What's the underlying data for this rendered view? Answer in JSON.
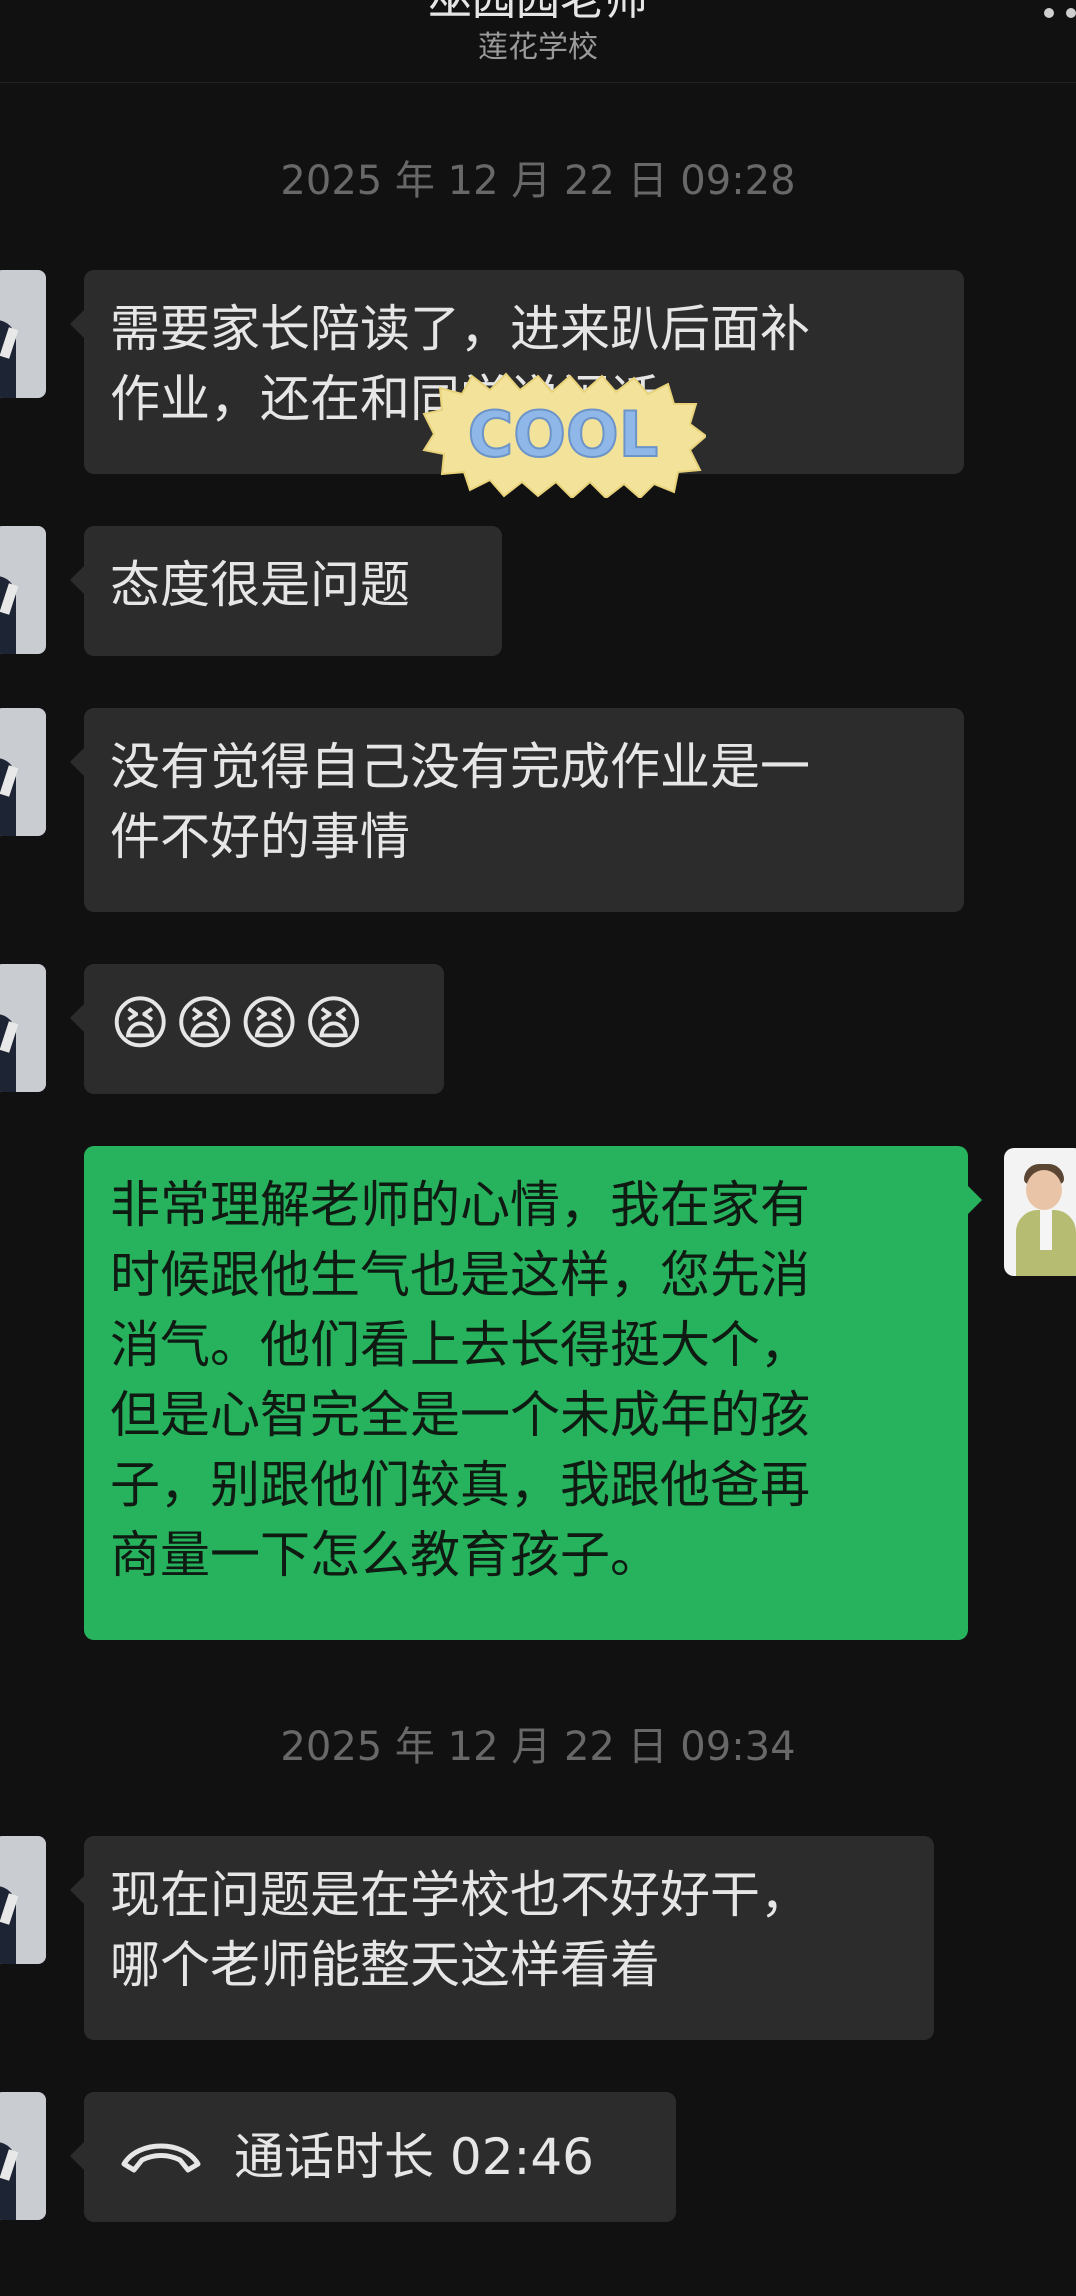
{
  "header": {
    "title": "巫园园老师",
    "subtitle": "莲花学校"
  },
  "messages": [
    {
      "type": "timestamp",
      "text": "2025 年 12 月 22 日 09:28"
    },
    {
      "type": "incoming",
      "text": "需要家长陪读了，进来趴后面补\n作业，还在和同学说闲话"
    },
    {
      "type": "incoming",
      "text": "态度很是问题"
    },
    {
      "type": "incoming",
      "text": "没有觉得自己没有完成作业是一\n件不好的事情"
    },
    {
      "type": "incoming",
      "text": "😫😫😫😫"
    },
    {
      "type": "outgoing",
      "text": "非常理解老师的心情，我在家有\n时候跟他生气也是这样，您先消\n消气。他们看上去长得挺大个，\n但是心智完全是一个未成年的孩\n子，别跟他们较真，我跟他爸再\n商量一下怎么教育孩子。"
    },
    {
      "type": "timestamp",
      "text": "2025 年 12 月 22 日 09:34"
    },
    {
      "type": "incoming",
      "text": "现在问题是在学校也不好好干，\n哪个老师能整天这样看着"
    },
    {
      "type": "call",
      "text": "通话时长 02:46",
      "icon": "phone-hangup-icon"
    }
  ],
  "sticker": {
    "text": "COOL",
    "icon": "cool-sticker-icon"
  },
  "colors": {
    "background": "#111111",
    "incoming_bubble": "#2c2c2c",
    "outgoing_bubble": "#27b35d",
    "timestamp": "#686868"
  }
}
